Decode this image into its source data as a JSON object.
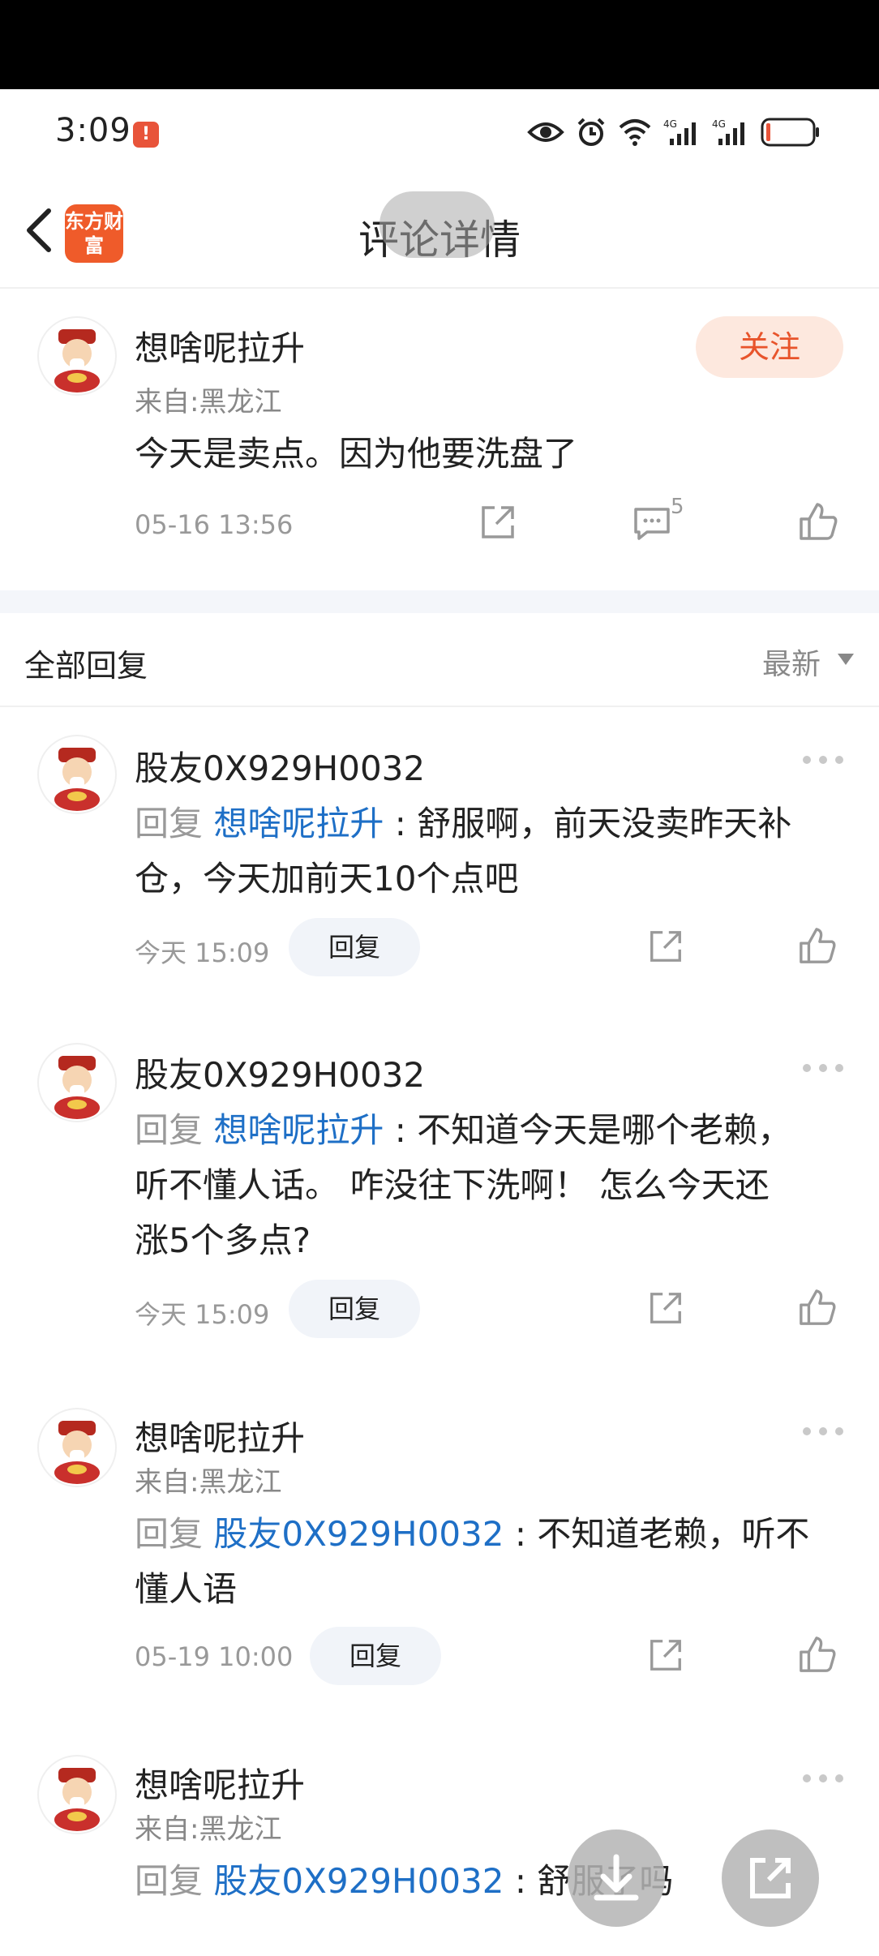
{
  "status_bar": {
    "time": "3:09",
    "battery_alert": "!"
  },
  "nav": {
    "title": "评论详情",
    "logo_text": "东方财富"
  },
  "post": {
    "author": "想啥呢拉升",
    "location": "来自:黑龙江",
    "content": "今天是卖点。因为他要洗盘了",
    "timestamp": "05-16 13:56",
    "comment_count": "5",
    "follow_label": "关注"
  },
  "replies_header": {
    "title": "全部回复",
    "sort_label": "最新"
  },
  "replies": [
    {
      "author": "股友0X929H0032",
      "location": "",
      "reply_prefix": "回复 ",
      "reply_to": "想啥呢拉升",
      "text_line1": " : 舒服啊，前天没卖昨天补",
      "text_line2": "仓，今天加前天10个点吧",
      "text_line3": "",
      "timestamp": "今天 15:09",
      "reply_label": "回复"
    },
    {
      "author": "股友0X929H0032",
      "location": "",
      "reply_prefix": "回复 ",
      "reply_to": "想啥呢拉升",
      "text_line1": " : 不知道今天是哪个老赖，",
      "text_line2": "听不懂人话。 咋没往下洗啊！ 怎么今天还",
      "text_line3": "涨5个多点?",
      "timestamp": "今天 15:09",
      "reply_label": "回复"
    },
    {
      "author": "想啥呢拉升",
      "location": "来自:黑龙江",
      "reply_prefix": "回复 ",
      "reply_to": "股友0X929H0032",
      "text_line1": " : 不知道老赖，听不",
      "text_line2": "懂人语",
      "text_line3": "",
      "timestamp": "05-19 10:00",
      "reply_label": "回复"
    },
    {
      "author": "想啥呢拉升",
      "location": "来自:黑龙江",
      "reply_prefix": "回复 ",
      "reply_to": "股友0X929H0032",
      "text_line1": " : 舒服了吗",
      "text_line2": "",
      "text_line3": "",
      "timestamp": "",
      "reply_label": ""
    }
  ],
  "colors": {
    "accent": "#e8542b",
    "link": "#1e6fc6",
    "follow_bg": "#fde8de"
  }
}
